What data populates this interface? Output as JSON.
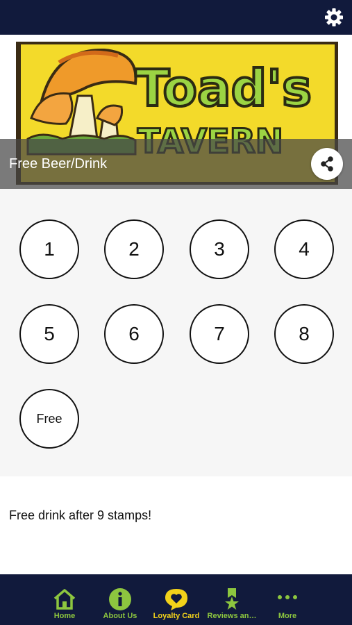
{
  "header": {
    "settings_icon": "gear-icon"
  },
  "hero": {
    "logo_text": "Toad's",
    "logo_subtext": "TAVERN",
    "title": "Free Beer/Drink",
    "share_icon": "share-icon"
  },
  "stamps": [
    {
      "label": "1"
    },
    {
      "label": "2"
    },
    {
      "label": "3"
    },
    {
      "label": "4"
    },
    {
      "label": "5"
    },
    {
      "label": "6"
    },
    {
      "label": "7"
    },
    {
      "label": "8"
    },
    {
      "label": "Free"
    }
  ],
  "info": {
    "text": "Free drink after 9 stamps!"
  },
  "tabbar": {
    "items": [
      {
        "label": "Home",
        "icon": "home-icon"
      },
      {
        "label": "About Us",
        "icon": "info-icon"
      },
      {
        "label": "Loyalty Card",
        "icon": "heart-badge-icon",
        "active": true
      },
      {
        "label": "Reviews an…",
        "icon": "ribbon-star-icon"
      },
      {
        "label": "More",
        "icon": "more-dots-icon"
      }
    ]
  },
  "colors": {
    "nav_background": "#111a3c",
    "tab_green": "#8dc63f",
    "tab_active_yellow": "#f2d21a",
    "stamp_area": "#f6f6f6"
  }
}
